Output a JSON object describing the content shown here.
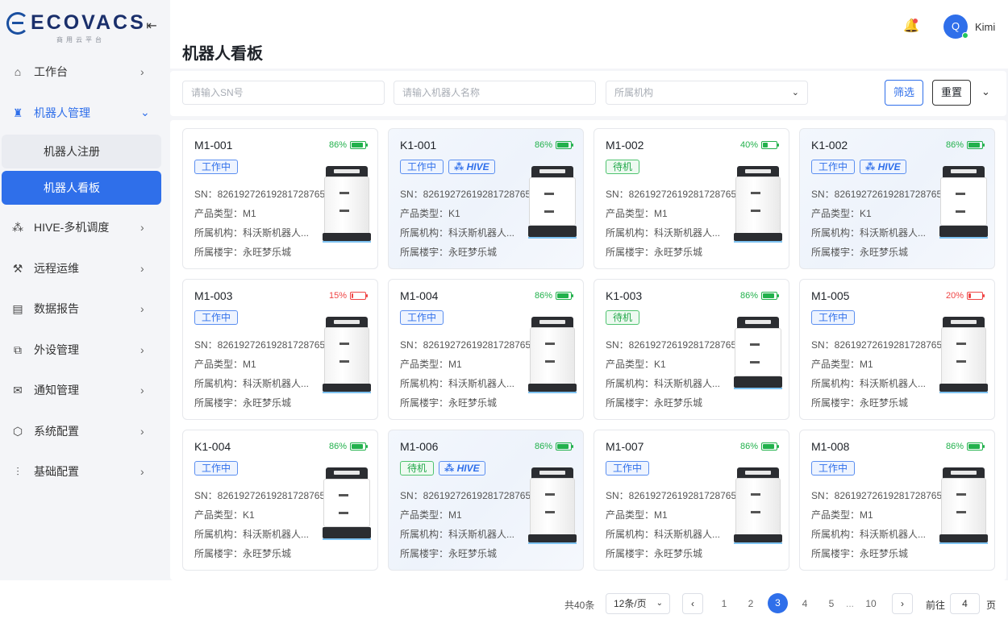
{
  "brand": {
    "name": "ECOVACS",
    "subtitle": "商用云平台"
  },
  "header": {
    "user_initial": "Q",
    "user_name": "Kimi",
    "page_title": "机器人看板"
  },
  "sidebar": {
    "items": [
      {
        "label": "工作台",
        "icon": "workbench-icon"
      },
      {
        "label": "机器人管理",
        "icon": "robot-icon",
        "active": true,
        "children": [
          {
            "label": "机器人注册"
          },
          {
            "label": "机器人看板",
            "selected": true
          }
        ]
      },
      {
        "label": "HIVE-多机调度",
        "icon": "hive-icon"
      },
      {
        "label": "远程运维",
        "icon": "tools-icon"
      },
      {
        "label": "数据报告",
        "icon": "chart-icon"
      },
      {
        "label": "外设管理",
        "icon": "peripheral-icon"
      },
      {
        "label": "通知管理",
        "icon": "mail-icon"
      },
      {
        "label": "系统配置",
        "icon": "cube-icon"
      },
      {
        "label": "基础配置",
        "icon": "sliders-icon"
      }
    ]
  },
  "filters": {
    "sn_placeholder": "请输入SN号",
    "name_placeholder": "请输入机器人名称",
    "org_placeholder": "所属机构",
    "filter_label": "筛选",
    "reset_label": "重置"
  },
  "labels": {
    "sn": "SN：",
    "type": "产品类型：",
    "org": "所属机构：",
    "building": "所属楼宇："
  },
  "robots": [
    {
      "name": "M1-001",
      "battery": "86%",
      "level": 0.86,
      "charging": false,
      "status": "工作中",
      "hive": false,
      "sn": "8261927261928172876​5",
      "type": "M1",
      "org": "科沃斯机器人...",
      "building": "永旺梦乐城"
    },
    {
      "name": "K1-001",
      "battery": "86%",
      "level": 0.86,
      "charging": false,
      "status": "工作中",
      "hive": true,
      "sn": "82619272619281728765",
      "type": "K1",
      "org": "科沃斯机器人...",
      "building": "永旺梦乐城"
    },
    {
      "name": "M1-002",
      "battery": "40%",
      "level": 0.4,
      "charging": true,
      "status": "待机",
      "hive": false,
      "sn": "82619272619281728765",
      "type": "M1",
      "org": "科沃斯机器人...",
      "building": "永旺梦乐城"
    },
    {
      "name": "K1-002",
      "battery": "86%",
      "level": 0.86,
      "charging": false,
      "status": "工作中",
      "hive": true,
      "sn": "82619272619281728765",
      "type": "K1",
      "org": "科沃斯机器人...",
      "building": "永旺梦乐城"
    },
    {
      "name": "M1-003",
      "battery": "15%",
      "level": 0.15,
      "charging": false,
      "status": "工作中",
      "hive": false,
      "sn": "82619272619281728765",
      "type": "M1",
      "org": "科沃斯机器人...",
      "building": "永旺梦乐城"
    },
    {
      "name": "M1-004",
      "battery": "86%",
      "level": 0.86,
      "charging": false,
      "status": "工作中",
      "hive": false,
      "sn": "82619272619281728765",
      "type": "M1",
      "org": "科沃斯机器人...",
      "building": "永旺梦乐城"
    },
    {
      "name": "K1-003",
      "battery": "86%",
      "level": 0.86,
      "charging": false,
      "status": "待机",
      "hive": false,
      "sn": "82619272619281728765",
      "type": "K1",
      "org": "科沃斯机器人...",
      "building": "永旺梦乐城"
    },
    {
      "name": "M1-005",
      "battery": "20%",
      "level": 0.2,
      "charging": false,
      "status": "工作中",
      "hive": false,
      "sn": "82619272619281728765",
      "type": "M1",
      "org": "科沃斯机器人...",
      "building": "永旺梦乐城"
    },
    {
      "name": "K1-004",
      "battery": "86%",
      "level": 0.86,
      "charging": false,
      "status": "工作中",
      "hive": false,
      "sn": "82619272619281728765",
      "type": "K1",
      "org": "科沃斯机器人...",
      "building": "永旺梦乐城"
    },
    {
      "name": "M1-006",
      "battery": "86%",
      "level": 0.86,
      "charging": false,
      "status": "待机",
      "hive": true,
      "sn": "82619272619281728765",
      "type": "M1",
      "org": "科沃斯机器人...",
      "building": "永旺梦乐城"
    },
    {
      "name": "M1-007",
      "battery": "86%",
      "level": 0.86,
      "charging": false,
      "status": "工作中",
      "hive": false,
      "sn": "82619272619281728765",
      "type": "M1",
      "org": "科沃斯机器人...",
      "building": "永旺梦乐城"
    },
    {
      "name": "M1-008",
      "battery": "86%",
      "level": 0.86,
      "charging": false,
      "status": "工作中",
      "hive": false,
      "sn": "82619272619281728765",
      "type": "M1",
      "org": "科沃斯机器人...",
      "building": "永旺梦乐城"
    }
  ],
  "hive_label": "HIVE",
  "pagination": {
    "total": "共40条",
    "page_size": "12条/页",
    "pages": [
      "1",
      "2",
      "3",
      "4",
      "5",
      "...",
      "10"
    ],
    "current": "3",
    "goto_label": "前往",
    "goto_value": "4",
    "goto_unit": "页"
  },
  "colors": {
    "accent": "#2f6fea",
    "ok": "#22b14c",
    "low": "#ef4444"
  }
}
